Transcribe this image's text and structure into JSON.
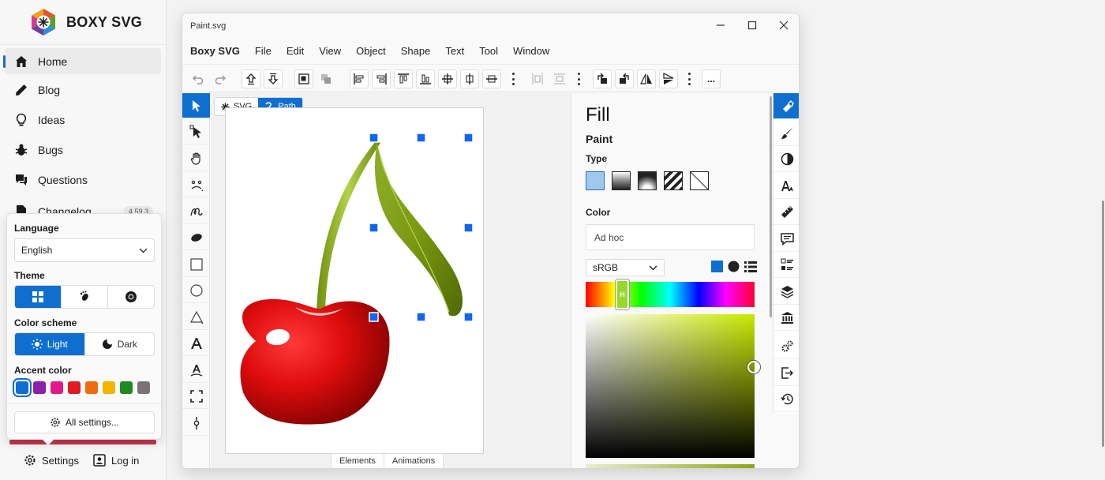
{
  "site": {
    "brand": "BOXY SVG",
    "nav": [
      {
        "label": "Home",
        "icon": "home-icon",
        "active": true
      },
      {
        "label": "Blog",
        "icon": "pencil-icon"
      },
      {
        "label": "Ideas",
        "icon": "lightbulb-icon"
      },
      {
        "label": "Bugs",
        "icon": "bug-icon"
      },
      {
        "label": "Questions",
        "icon": "chat-icon"
      },
      {
        "label": "Changelog",
        "icon": "document-icon",
        "badge": "4.59.3"
      }
    ],
    "bottom": {
      "settings_label": "Settings",
      "login_label": "Log in"
    }
  },
  "settings_popup": {
    "language_label": "Language",
    "language_value": "English",
    "theme_label": "Theme",
    "color_scheme_label": "Color scheme",
    "light_label": "Light",
    "dark_label": "Dark",
    "accent_label": "Accent color",
    "accent_colors": [
      "#0f6fcf",
      "#8b1fa9",
      "#e3198a",
      "#e01b24",
      "#f06a0f",
      "#f4b400",
      "#1f8a1f",
      "#7a7574"
    ],
    "all_settings_label": "All settings..."
  },
  "app": {
    "title": "Paint.svg",
    "menu": [
      "Boxy SVG",
      "File",
      "Edit",
      "View",
      "Object",
      "Shape",
      "Text",
      "Tool",
      "Window"
    ],
    "doc_tabs": {
      "svg_label": "SVG",
      "path_label": "Path"
    },
    "bottom_tabs": [
      "Elements",
      "Animations"
    ],
    "more_label": "..."
  },
  "fill_panel": {
    "title": "Fill",
    "paint_label": "Paint",
    "type_label": "Type",
    "color_label": "Color",
    "adhoc_placeholder": "Ad hoc",
    "color_space": "sRGB",
    "hue_handle_label": "H",
    "selected_color": "#c8e800"
  },
  "accent": "#0f6fcf"
}
